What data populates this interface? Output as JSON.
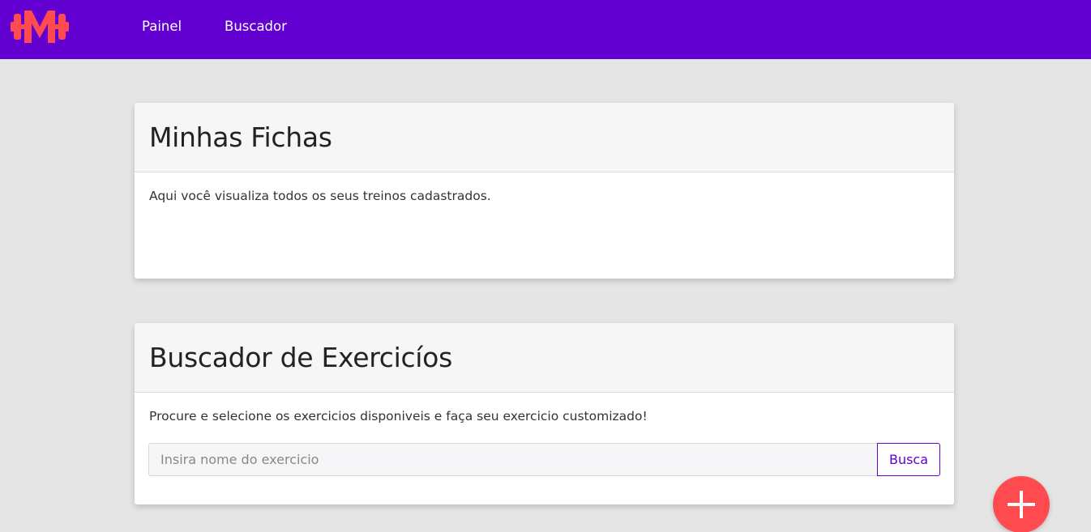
{
  "navbar": {
    "brand_color": "#6200d2",
    "logo_icon": "dumbbell-m-icon",
    "links": [
      {
        "label": "Painel"
      },
      {
        "label": "Buscador"
      }
    ]
  },
  "fichas_card": {
    "title": "Minhas Fichas",
    "description": "Aqui você visualiza todos os seus treinos cadastrados."
  },
  "buscador_card": {
    "title": "Buscador de Exercicíos",
    "description": "Procure e selecione os exercicios disponiveis e faça seu exercicio customizado!",
    "search": {
      "placeholder": "Insira nome do exercicio",
      "value": "",
      "button_label": "Busca"
    }
  },
  "fab": {
    "icon": "plus-icon",
    "color": "#ff4a4f"
  }
}
